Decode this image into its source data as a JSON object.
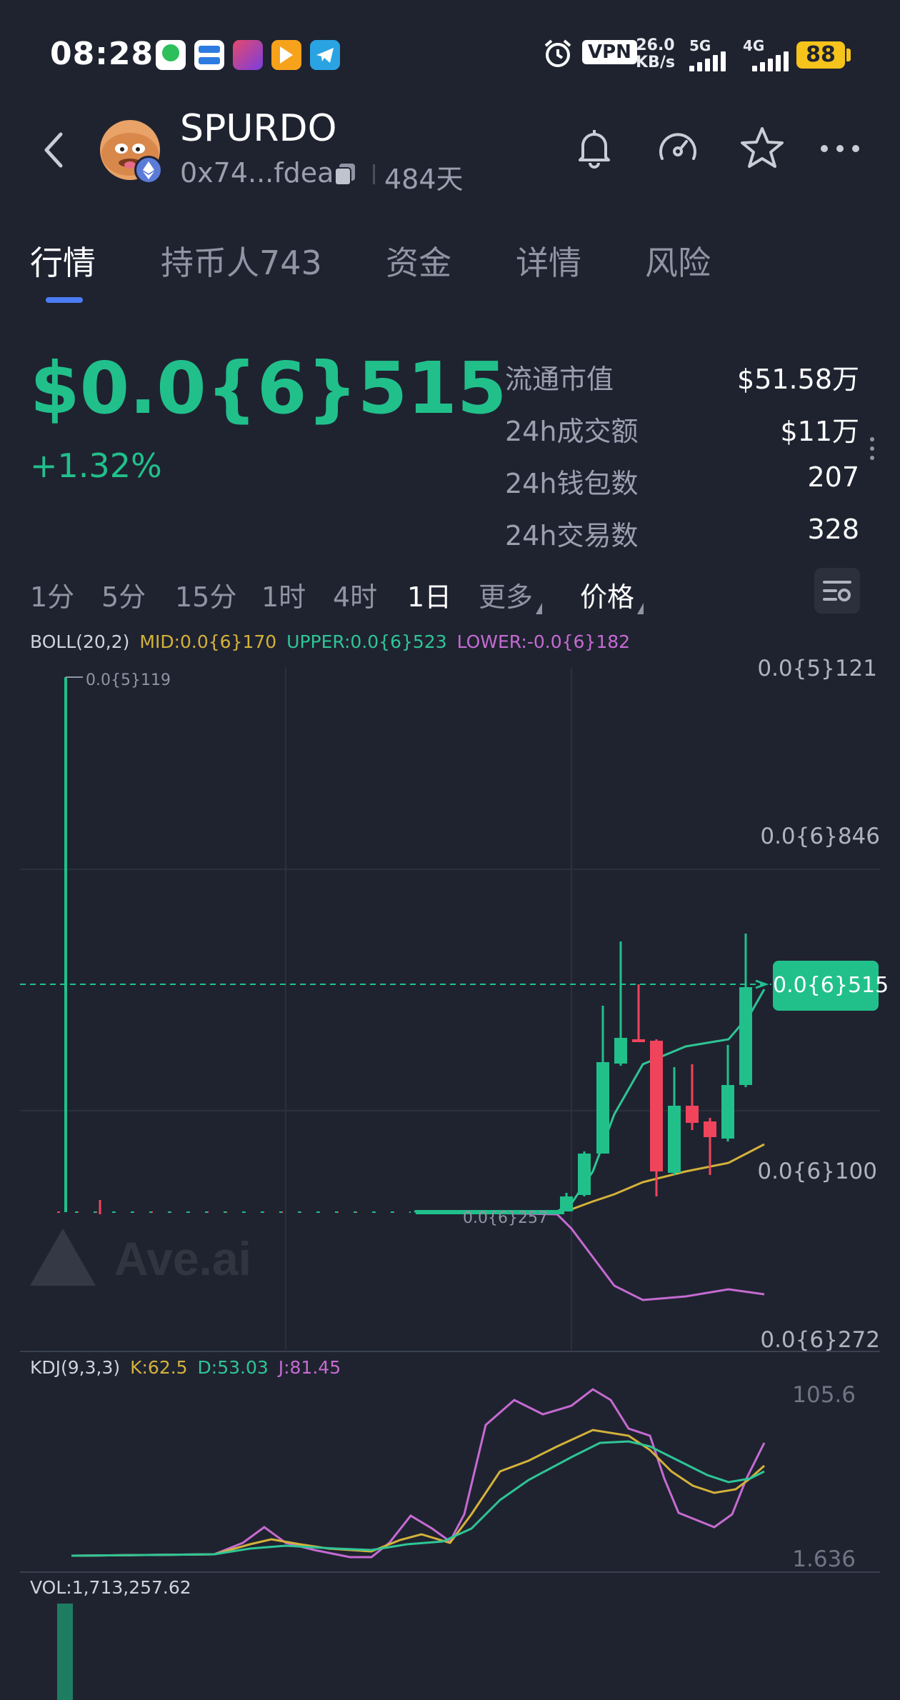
{
  "status_bar": {
    "time": "08:28",
    "vpn": "VPN",
    "speed_value": "26.0",
    "speed_unit": "KB/s",
    "net1": "5G",
    "net2": "4G",
    "battery": "88"
  },
  "header": {
    "coin_name": "SPURDO",
    "address": "0x74...fdea",
    "age": "484天"
  },
  "tabs": [
    "行情",
    "持币人743",
    "资金",
    "详情",
    "风险"
  ],
  "active_tab": "行情",
  "price": {
    "value": "$0.0{6}515",
    "change": "+1.32%"
  },
  "stats": [
    {
      "label": "流通市值",
      "value": "$51.58万"
    },
    {
      "label": "24h成交额",
      "value": "$11万"
    },
    {
      "label": "24h钱包数",
      "value": "207"
    },
    {
      "label": "24h交易数",
      "value": "328"
    }
  ],
  "timeframes": [
    "1分",
    "5分",
    "15分",
    "1时",
    "4时",
    "1日",
    "更多",
    "价格"
  ],
  "active_timeframe": "1日",
  "boll": {
    "name": "BOLL(20,2)",
    "mid": "MID:0.0{6}170",
    "upper": "UPPER:0.0{6}523",
    "lower": "LOWER:-0.0{6}182",
    "colors": {
      "mid": "#d4b23a",
      "upper": "#2fc596",
      "lower": "#c56bd1"
    }
  },
  "price_axis": [
    "0.0{5}121",
    "0.0{6}846",
    "0.0{6}100",
    "0.0{6}272"
  ],
  "chart_annotations": {
    "max": "0.0{5}119",
    "min": "0.0{6}257",
    "current": "0.0{6}515"
  },
  "watermark": "Ave.ai",
  "kdj": {
    "name": "KDJ(9,3,3)",
    "k": "K:62.5",
    "d": "D:53.03",
    "j": "J:81.45",
    "axis_top": "105.6",
    "axis_bottom": "1.636",
    "colors": {
      "k": "#d4b23a",
      "d": "#2fc596",
      "j": "#c56bd1"
    }
  },
  "volume": {
    "label": "VOL:1,713,257.62"
  },
  "colors": {
    "up": "#21c08b",
    "down": "#f0445c",
    "accent": "#4b7cf3",
    "background": "#1f2330"
  }
}
